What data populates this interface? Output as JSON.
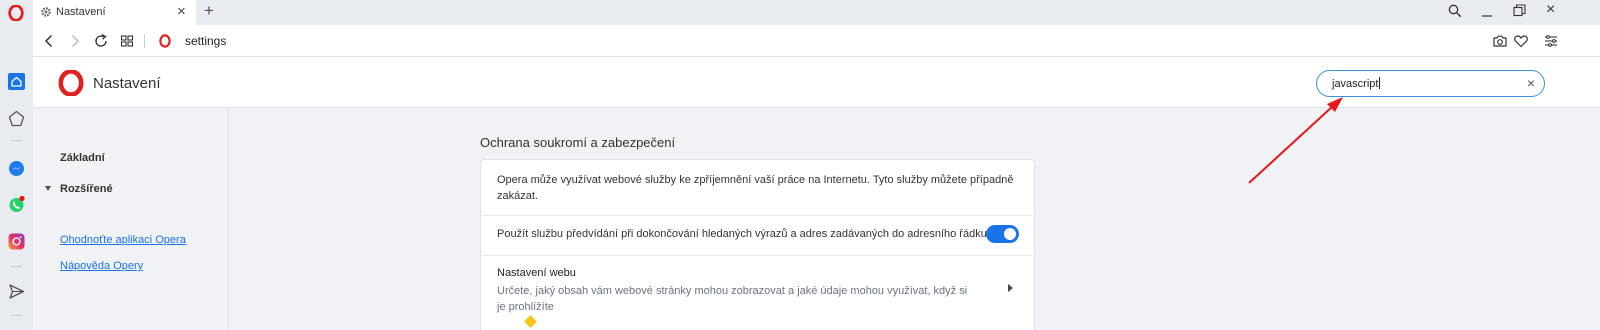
{
  "browser": {
    "tab_title": "Nastavení",
    "address_text": "settings"
  },
  "settings": {
    "header_title": "Nastavení",
    "search_value": "javascript",
    "nav": {
      "basic": "Základní",
      "advanced": "Rozšířené",
      "links": [
        "Ohodnoťte aplikaci Opera",
        "Nápověda Opery"
      ]
    },
    "section_title": "Ochrana soukromí a zabezpečení",
    "rows": {
      "services_text": "Opera může využívat webové služby ke zpříjemnění vaší práce na Internetu. Tyto služby můžete případně zakázat.",
      "prediction_text": "Použít službu předvídání při dokončování hledaných výrazů a adres zadávaných do adresního řádku",
      "prediction_enabled": true,
      "site_settings_title": "Nastavení webu",
      "site_settings_desc": "Určete, jaký obsah vám webové stránky mohou zobrazovat a jaké údaje mohou využívat, když si je prohlížíte"
    }
  },
  "colors": {
    "accent": "#1a73e8",
    "opera_red": "#e0211f",
    "annotation_arrow": "#e8141a",
    "sidebar_bg": "#e8ecf1",
    "content_bg": "#f0f2f5"
  },
  "icons": [
    "opera-logo-icon",
    "gear-icon",
    "close-icon",
    "plus-icon",
    "search-icon",
    "minimize-icon",
    "restore-icon",
    "back-icon",
    "forward-icon",
    "reload-icon",
    "tabs-grid-icon",
    "camera-icon",
    "heart-icon",
    "easy-setup-icon",
    "home-icon",
    "speed-dial-icon",
    "messenger-icon",
    "whatsapp-icon",
    "instagram-icon",
    "send-icon",
    "clear-icon",
    "chevron-right-icon"
  ]
}
